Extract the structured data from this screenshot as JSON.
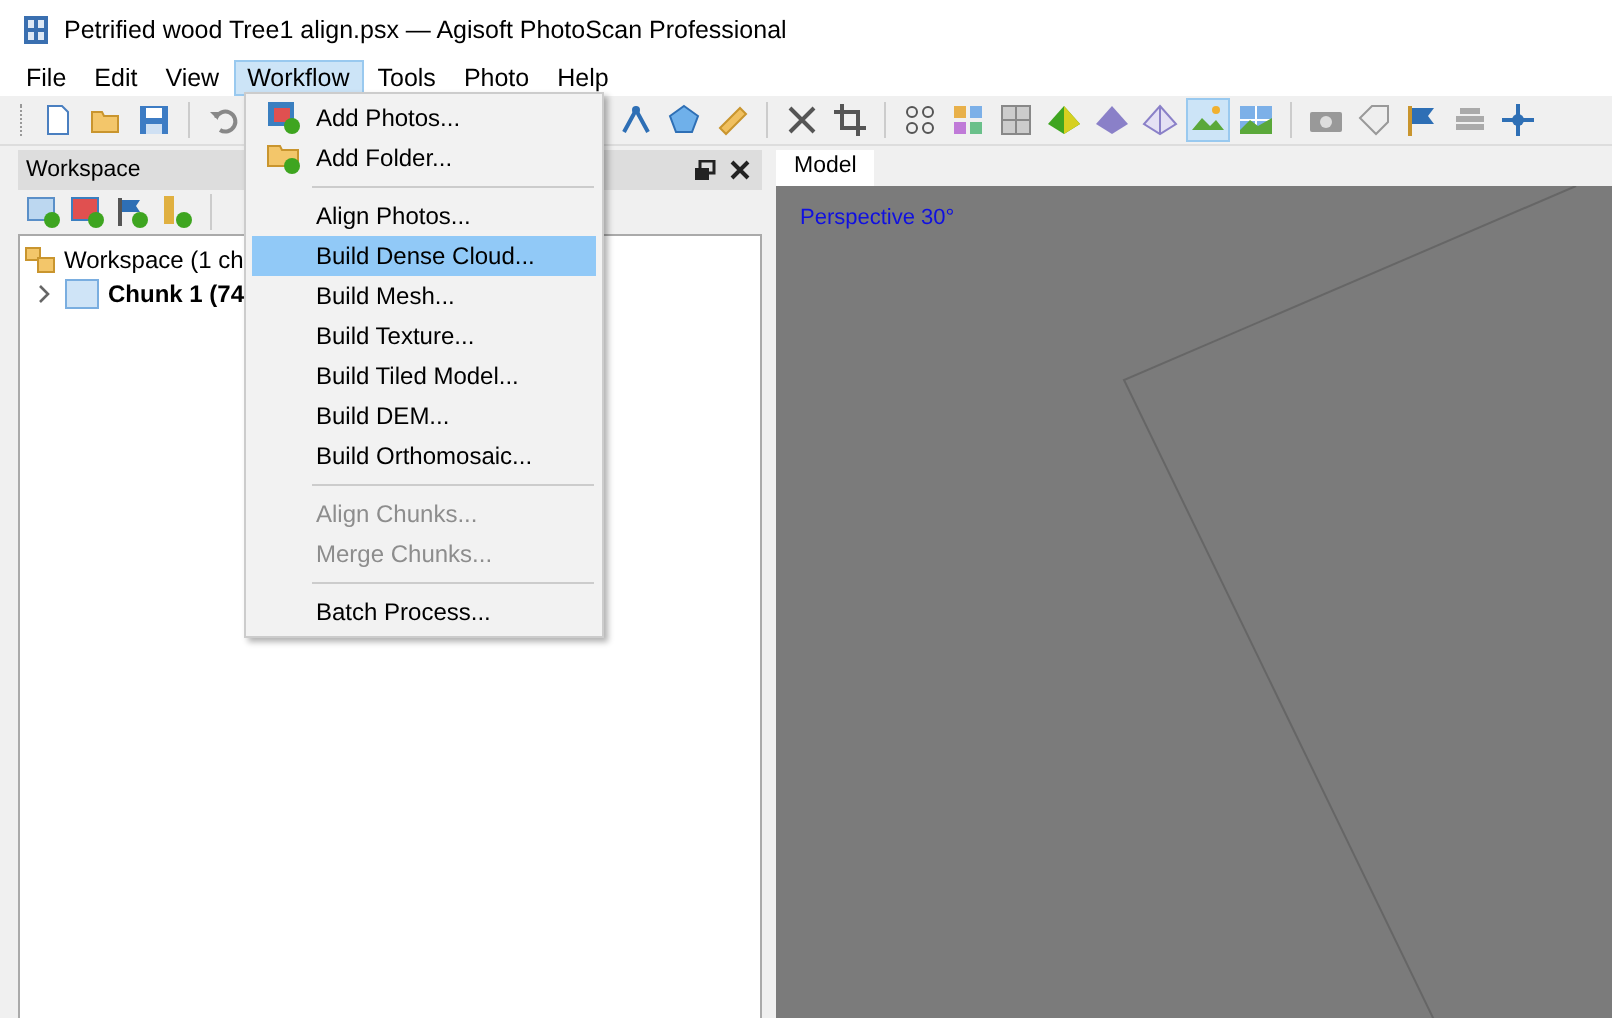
{
  "window": {
    "title": "Petrified wood Tree1 align.psx — Agisoft PhotoScan Professional"
  },
  "menubar": [
    {
      "label": "File",
      "selected": false
    },
    {
      "label": "Edit",
      "selected": false
    },
    {
      "label": "View",
      "selected": false
    },
    {
      "label": "Workflow",
      "selected": true
    },
    {
      "label": "Tools",
      "selected": false
    },
    {
      "label": "Photo",
      "selected": false
    },
    {
      "label": "Help",
      "selected": false
    }
  ],
  "toolbar_left": [
    {
      "kind": "new",
      "selected": false
    },
    {
      "kind": "open",
      "selected": false
    },
    {
      "kind": "save",
      "selected": false
    },
    {
      "kind": "undo",
      "selected": false
    }
  ],
  "toolbar_right": [
    {
      "kind": "measure",
      "selected": false
    },
    {
      "kind": "pentagon",
      "selected": false
    },
    {
      "kind": "ruler",
      "selected": false
    },
    {
      "kind": "cross",
      "selected": false
    },
    {
      "kind": "crop",
      "selected": false
    },
    {
      "kind": "dots",
      "selected": false
    },
    {
      "kind": "colorgrid",
      "selected": false
    },
    {
      "kind": "grid",
      "selected": false
    },
    {
      "kind": "solid",
      "selected": false
    },
    {
      "kind": "shaded",
      "selected": false
    },
    {
      "kind": "wire",
      "selected": false
    },
    {
      "kind": "textured",
      "selected": true
    },
    {
      "kind": "tiled",
      "selected": false
    },
    {
      "kind": "camera",
      "selected": false
    },
    {
      "kind": "tag",
      "selected": false
    },
    {
      "kind": "flag",
      "selected": false
    },
    {
      "kind": "stack",
      "selected": false
    },
    {
      "kind": "move",
      "selected": false
    }
  ],
  "workspace": {
    "title": "Workspace",
    "tree": [
      {
        "label": "Workspace (1 ch",
        "children": [
          {
            "label": "Chunk 1 (74",
            "expanded": false
          }
        ]
      }
    ]
  },
  "menu": [
    {
      "kind": "item",
      "label": "Add Photos...",
      "disabled": false,
      "selected": false
    },
    {
      "kind": "item",
      "label": "Add Folder...",
      "disabled": false,
      "selected": false
    },
    {
      "kind": "separator"
    },
    {
      "kind": "item",
      "label": "Align Photos...",
      "disabled": false,
      "selected": false
    },
    {
      "kind": "item",
      "label": "Build Dense Cloud...",
      "disabled": false,
      "selected": true
    },
    {
      "kind": "item",
      "label": "Build Mesh...",
      "disabled": false,
      "selected": false
    },
    {
      "kind": "item",
      "label": "Build Texture...",
      "disabled": false,
      "selected": false
    },
    {
      "kind": "item",
      "label": "Build Tiled Model...",
      "disabled": false,
      "selected": false
    },
    {
      "kind": "item",
      "label": "Build DEM...",
      "disabled": false,
      "selected": false
    },
    {
      "kind": "item",
      "label": "Build Orthomosaic...",
      "disabled": false,
      "selected": false
    },
    {
      "kind": "separator"
    },
    {
      "kind": "item",
      "label": "Align Chunks...",
      "disabled": true,
      "selected": false
    },
    {
      "kind": "item",
      "label": "Merge Chunks...",
      "disabled": true,
      "selected": false
    },
    {
      "kind": "separator"
    },
    {
      "kind": "item",
      "label": "Batch Process...",
      "disabled": false,
      "selected": false
    }
  ],
  "model": {
    "tabs": [
      {
        "label": "Model",
        "selected": true
      }
    ],
    "view_label": "Perspective 30°"
  }
}
